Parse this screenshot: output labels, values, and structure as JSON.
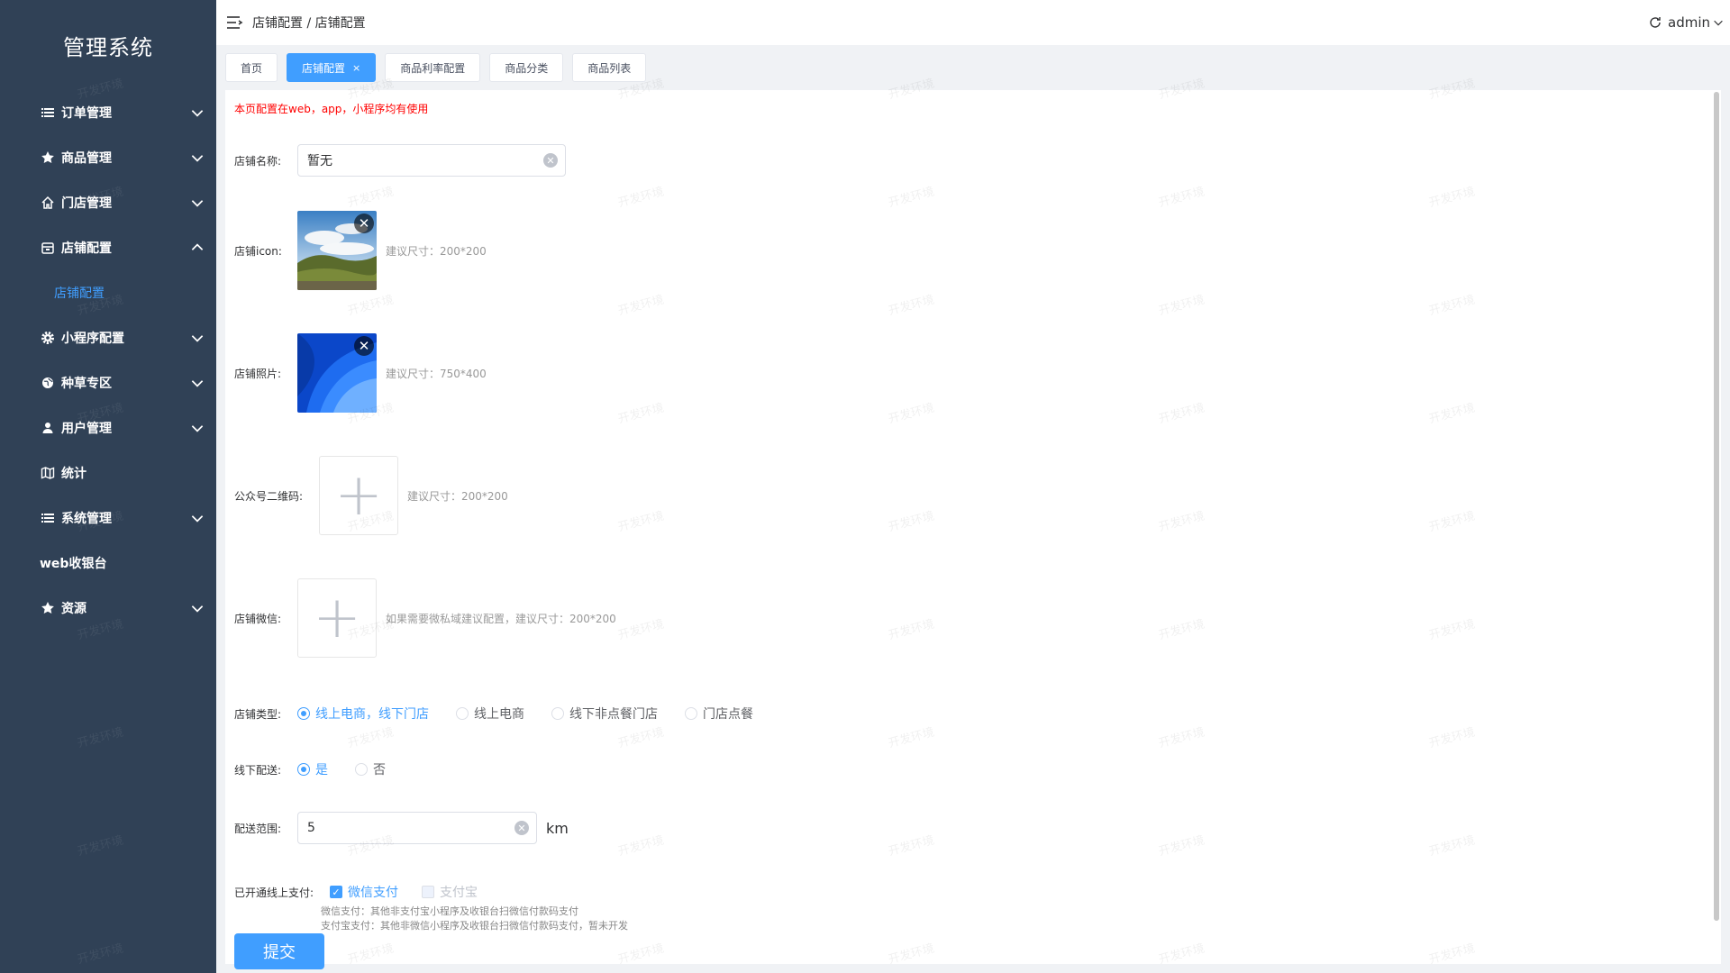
{
  "app": {
    "title": "管理系统"
  },
  "sidebar": {
    "items": [
      {
        "label": "订单管理",
        "icon": "list-icon"
      },
      {
        "label": "商品管理",
        "icon": "star-icon"
      },
      {
        "label": "门店管理",
        "icon": "home-icon"
      },
      {
        "label": "店铺配置",
        "icon": "shop-icon",
        "expanded": true,
        "children": [
          {
            "label": "店铺配置",
            "active": true
          }
        ]
      },
      {
        "label": "小程序配置",
        "icon": "gear-icon"
      },
      {
        "label": "种草专区",
        "icon": "globe-icon"
      },
      {
        "label": "用户管理",
        "icon": "user-icon"
      },
      {
        "label": "统计",
        "icon": "map-icon"
      },
      {
        "label": "系统管理",
        "icon": "list-icon"
      },
      {
        "label": "web收银台"
      },
      {
        "label": "资源",
        "icon": "star-icon"
      }
    ]
  },
  "header": {
    "breadcrumb": "店铺配置 / 店铺配置",
    "user": "admin"
  },
  "tags": [
    {
      "label": "首页",
      "active": false
    },
    {
      "label": "店铺配置",
      "active": true,
      "close": "×"
    },
    {
      "label": "商品利率配置",
      "active": false
    },
    {
      "label": "商品分类",
      "active": false
    },
    {
      "label": "商品列表",
      "active": false
    }
  ],
  "form": {
    "notice": "本页配置在web，app，小程序均有使用",
    "shop_name": {
      "label": "店铺名称:",
      "value": "暂无"
    },
    "shop_icon": {
      "label": "店铺icon:",
      "hint": "建议尺寸：200*200"
    },
    "shop_photo": {
      "label": "店铺照片:",
      "hint": "建议尺寸：750*400"
    },
    "qrcode": {
      "label": "公众号二维码:",
      "hint": "建议尺寸：200*200"
    },
    "wechat": {
      "label": "店铺微信:",
      "hint": "如果需要微私域建议配置，建议尺寸：200*200"
    },
    "shop_type": {
      "label": "店铺类型:",
      "options": [
        "线上电商，线下门店",
        "线上电商",
        "线下非点餐门店",
        "门店点餐"
      ],
      "selected": "线上电商，线下门店"
    },
    "offline_delivery": {
      "label": "线下配送:",
      "options": [
        "是",
        "否"
      ],
      "selected": "是"
    },
    "delivery_range": {
      "label": "配送范围:",
      "value": "5",
      "unit": "km"
    },
    "online_pay": {
      "label": "已开通线上支付:",
      "options": [
        {
          "label": "微信支付",
          "checked": true
        },
        {
          "label": "支付宝",
          "checked": false,
          "disabled": true
        }
      ],
      "hint1": "微信支付：其他非支付宝小程序及收银台扫微信付款码支付",
      "hint2": "支付宝支付：其他非微信小程序及收银台扫微信付款码支付，暂未开发"
    },
    "submit_label": "提交"
  },
  "watermark": "开发环境",
  "colors": {
    "sidebar_bg": "#304156",
    "accent": "#409eff",
    "notice": "#ff0000"
  }
}
